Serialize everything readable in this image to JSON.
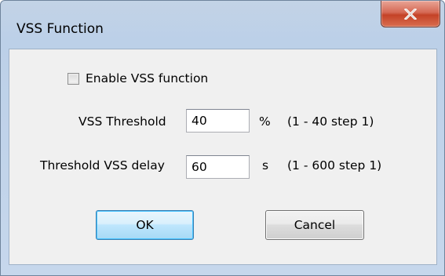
{
  "window": {
    "title": "VSS Function",
    "close_icon": "close-icon"
  },
  "enable_checkbox": {
    "label": "Enable VSS function",
    "checked": false
  },
  "threshold": {
    "label": "VSS Threshold",
    "value": "40",
    "unit": "%",
    "range": "(1 - 40 step 1)"
  },
  "delay": {
    "label": "Threshold VSS delay",
    "value": "60",
    "unit": "s",
    "range": "(1 - 600 step 1)"
  },
  "buttons": {
    "ok": "OK",
    "cancel": "Cancel"
  },
  "colors": {
    "close_button": "#c44227",
    "ok_border": "#3c7fb1"
  }
}
